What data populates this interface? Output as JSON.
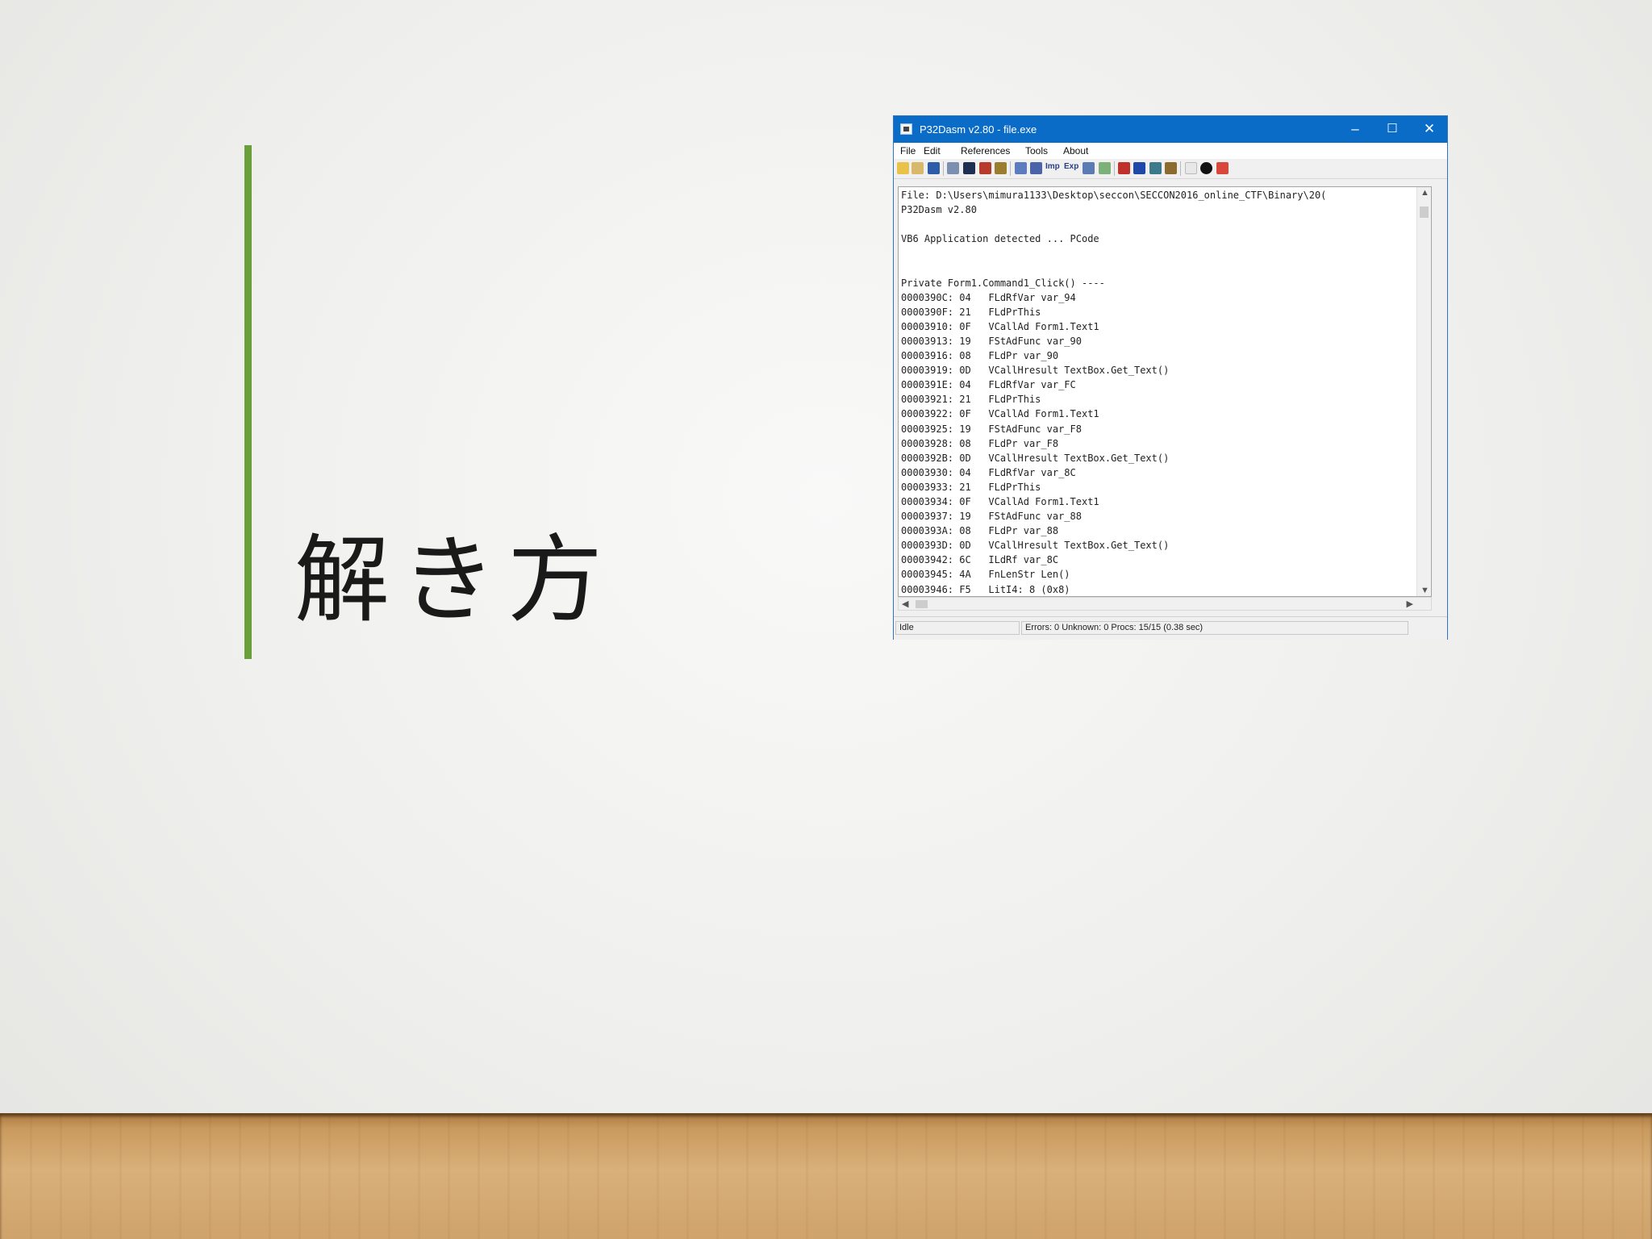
{
  "slide": {
    "title": "解き方"
  },
  "window": {
    "title": "P32Dasm v2.80 - file.exe",
    "controls": {
      "minimize": "–",
      "maximize": "☐",
      "close": "✕"
    },
    "menu": [
      "File",
      "Edit",
      "References",
      "Tools",
      "About"
    ],
    "toolbar_icons": [
      "open-folder-icon",
      "export-icon",
      "save-icon",
      "copy-icon",
      "find-icon",
      "bug-icon",
      "settings-icon",
      "tree-icon",
      "filter-icon",
      "imports-icon",
      "exports-icon",
      "table-icon",
      "arrow-icon",
      "jump-icon",
      "block-icon",
      "image-icon",
      "hand-icon",
      "page-icon",
      "info-icon",
      "exit-icon"
    ],
    "toolbar_labels": {
      "imp": "Imp",
      "exp": "Exp"
    },
    "code_lines": [
      "File: D:\\Users\\mimura1133\\Desktop\\seccon\\SECCON2016_online_CTF\\Binary\\20(",
      "P32Dasm v2.80",
      "",
      "VB6 Application detected ... PCode",
      "",
      "",
      "Private Form1.Command1_Click() ----",
      "0000390C: 04   FLdRfVar var_94",
      "0000390F: 21   FLdPrThis",
      "00003910: 0F   VCallAd Form1.Text1",
      "00003913: 19   FStAdFunc var_90",
      "00003916: 08   FLdPr var_90",
      "00003919: 0D   VCallHresult TextBox.Get_Text()",
      "0000391E: 04   FLdRfVar var_FC",
      "00003921: 21   FLdPrThis",
      "00003922: 0F   VCallAd Form1.Text1",
      "00003925: 19   FStAdFunc var_F8",
      "00003928: 08   FLdPr var_F8",
      "0000392B: 0D   VCallHresult TextBox.Get_Text()",
      "00003930: 04   FLdRfVar var_8C",
      "00003933: 21   FLdPrThis",
      "00003934: 0F   VCallAd Form1.Text1",
      "00003937: 19   FStAdFunc var_88",
      "0000393A: 08   FLdPr var_88",
      "0000393D: 0D   VCallHresult TextBox.Get_Text()",
      "00003942: 6C   ILdRf var_8C",
      "00003945: 4A   FnLenStr Len()",
      "00003946: F5   LitI4: 8 (0x8)"
    ],
    "status": {
      "state": "Idle",
      "summary": "Errors: 0   Unknown: 0   Procs: 15/15   (0.38 sec)"
    }
  },
  "colors": {
    "accent_bar": "#6aa03c",
    "titlebar": "#0b6cc8"
  }
}
